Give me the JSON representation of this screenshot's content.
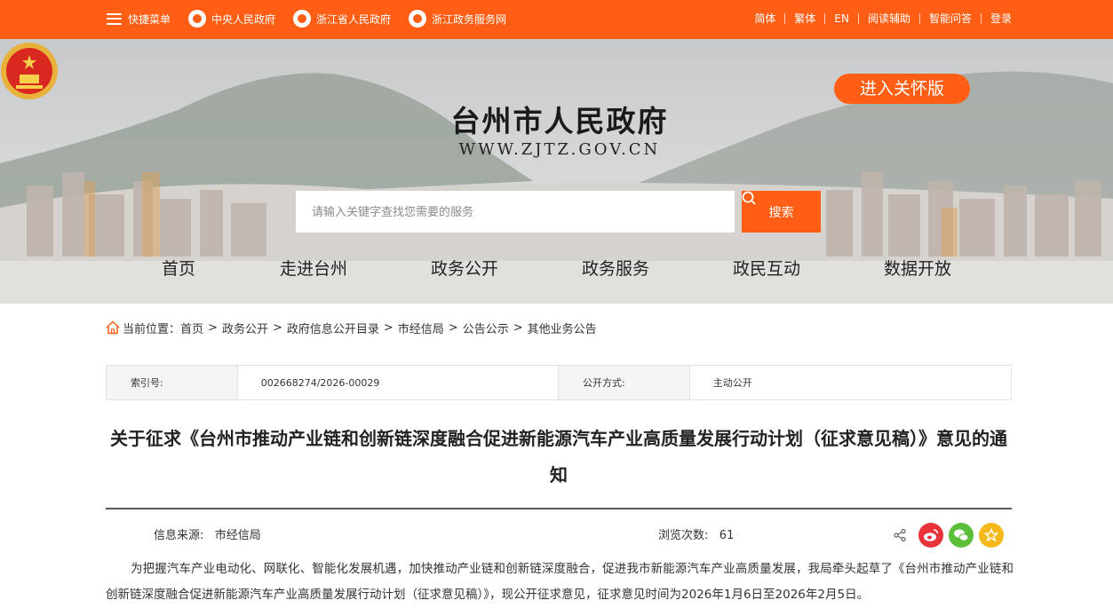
{
  "topbar": {
    "quick_menu": "快捷菜单",
    "links": [
      "中央人民政府",
      "浙江省人民政府",
      "浙江政务服务网"
    ],
    "right_links": [
      "简体",
      "繁体",
      "EN",
      "阅读辅助",
      "智能问答",
      "登录"
    ]
  },
  "banner": {
    "site_title": "台州市人民政府",
    "site_url": "WWW.ZJTZ.GOV.CN",
    "care_button": "进入关怀版",
    "search_placeholder": "请输入关键字查找您需要的服务",
    "search_button": "搜索"
  },
  "nav": [
    "首页",
    "走进台州",
    "政务公开",
    "政务服务",
    "政民互动",
    "数据开放"
  ],
  "breadcrumb": {
    "label": "当前位置：",
    "items": [
      "首页",
      "政务公开",
      "政府信息公开目录",
      "市经信局",
      "公告公示",
      "其他业务公告"
    ]
  },
  "meta": {
    "index_label": "索引号:",
    "index_value": "002668274/2026-00029",
    "mode_label": "公开方式:",
    "mode_value": "主动公开"
  },
  "article": {
    "title": "关于征求《台州市推动产业链和创新链深度融合促进新能源汽车产业高质量发展行动计划（征求意见稿）》意见的通知",
    "source_label": "信息来源:",
    "source_value": "市经信局",
    "views_label": "浏览次数:",
    "views_value": "61",
    "body": "为把握汽车产业电动化、网联化、智能化发展机遇，加快推动产业链和创新链深度融合，促进我市新能源汽车产业高质量发展，我局牵头起草了《台州市推动产业链和创新链深度融合促进新能源汽车产业高质量发展行动计划（征求意见稿）》，现公开征求意见，征求意见时间为2026年1月6日至2026年2月5日。"
  },
  "colors": {
    "accent": "#ff5e14",
    "weibo": "#e8333a",
    "wechat": "#5bbf3a",
    "favorite": "#f5b81a"
  },
  "icons": [
    "menu-icon",
    "emblem-icon",
    "search-icon",
    "home-icon",
    "share-icon",
    "weibo-icon",
    "wechat-icon",
    "favorite-icon"
  ]
}
